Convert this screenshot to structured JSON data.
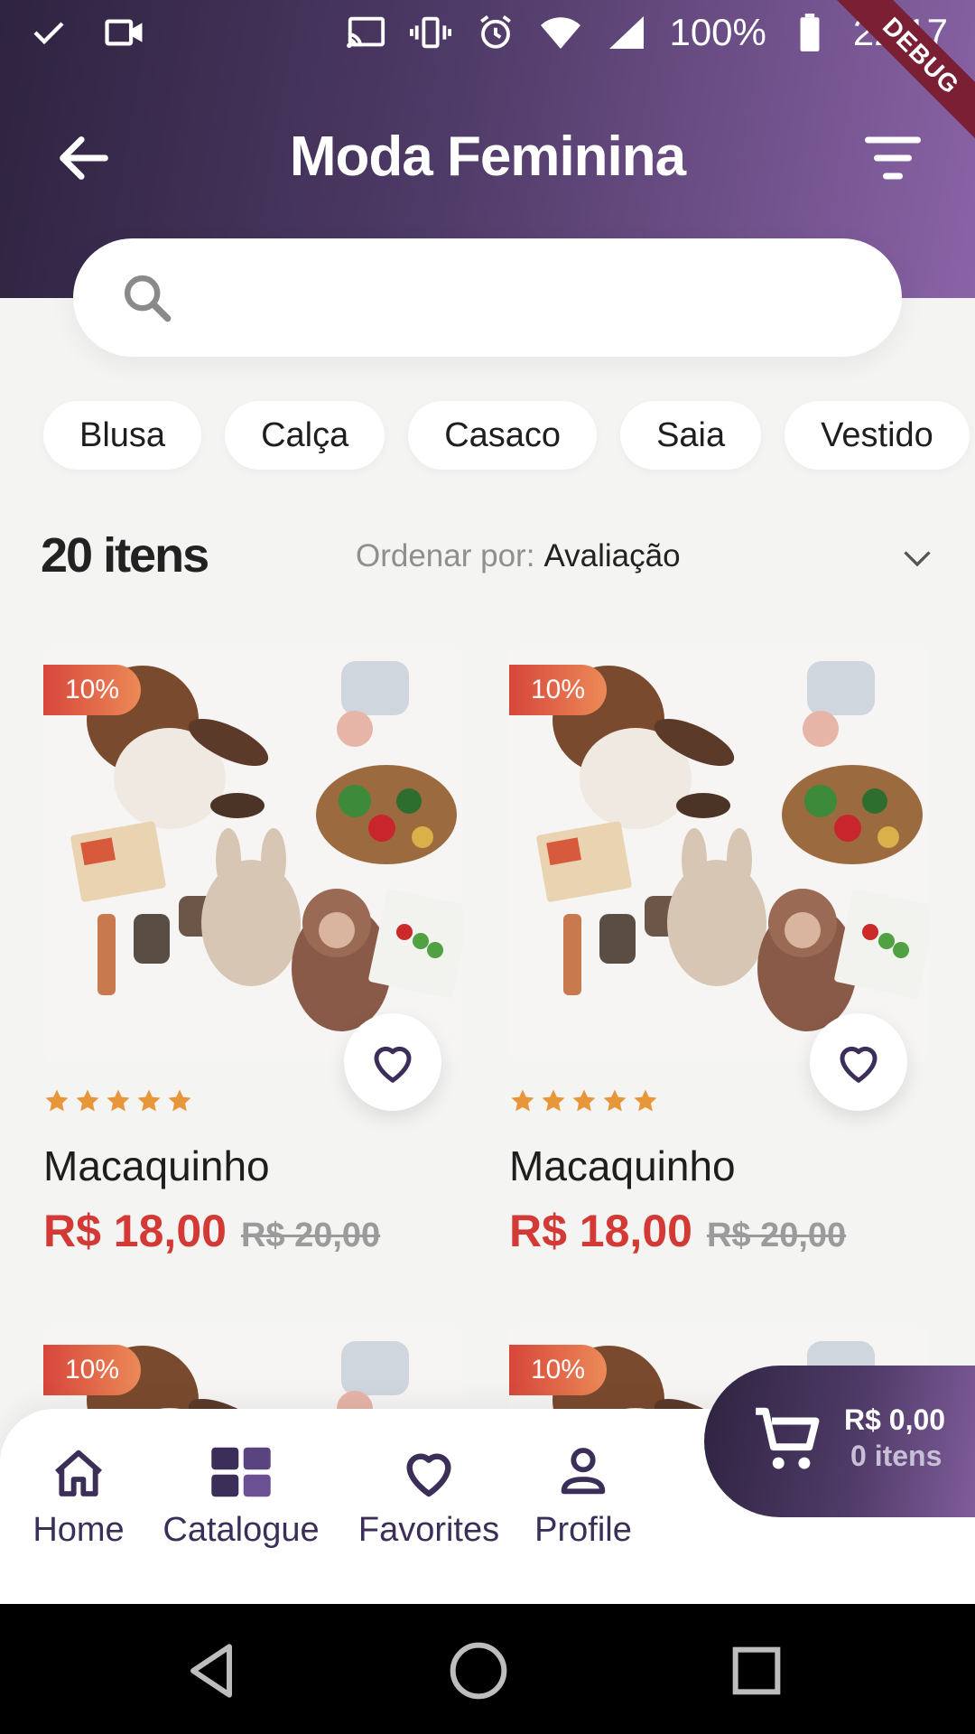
{
  "status_bar": {
    "battery": "100%",
    "time": "22:17",
    "debug_label": "DEBUG"
  },
  "header": {
    "title": "Moda Feminina"
  },
  "search": {
    "placeholder": ""
  },
  "categories": [
    "Blusa",
    "Calça",
    "Casaco",
    "Saia",
    "Vestido"
  ],
  "listing": {
    "count": "20 itens",
    "order_label": "Ordenar por:",
    "order_value": "Avaliação"
  },
  "products": [
    {
      "badge": "10%",
      "name": "Macaquinho",
      "price": "R$ 18,00",
      "old_price": "R$ 20,00",
      "rating": 5
    },
    {
      "badge": "10%",
      "name": "Macaquinho",
      "price": "R$ 18,00",
      "old_price": "R$ 20,00",
      "rating": 5
    },
    {
      "badge": "10%"
    },
    {
      "badge": "10%"
    }
  ],
  "bottom_nav": [
    {
      "label": "Home",
      "icon": "home-icon"
    },
    {
      "label": "Catalogue",
      "icon": "grid-icon"
    },
    {
      "label": "Favorites",
      "icon": "heart-icon"
    },
    {
      "label": "Profile",
      "icon": "person-icon"
    }
  ],
  "cart": {
    "total": "R$ 0,00",
    "items": "0 itens"
  },
  "colors": {
    "header_start": "#2e2340",
    "header_end": "#8a63a6",
    "price": "#d33a36",
    "star": "#e8963a",
    "background": "#f4f4f2"
  }
}
